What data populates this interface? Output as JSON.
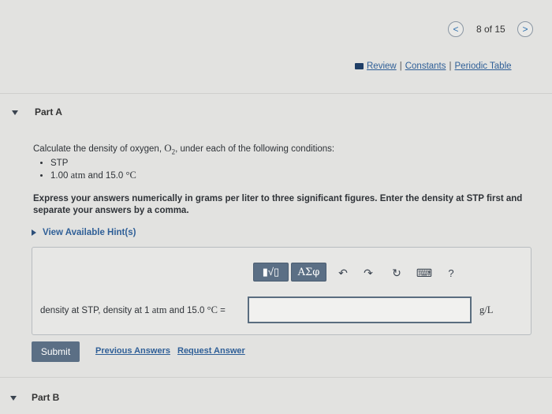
{
  "nav": {
    "prev_glyph": "<",
    "next_glyph": ">",
    "page_count": "8 of 15"
  },
  "links": {
    "review": "Review",
    "constants": "Constants",
    "periodic_table": "Periodic Table",
    "separator": "|"
  },
  "part_a": {
    "title": "Part A",
    "question_prefix": "Calculate the density of oxygen, ",
    "oxygen_symbol": "O",
    "oxygen_subscript": "2",
    "question_suffix": ", under each of the following conditions:",
    "conditions": [
      {
        "text": "STP"
      },
      {
        "value": "1.00",
        "unit": "atm",
        "mid": " and 15.0 ",
        "temp_unit": "°C"
      }
    ],
    "instruction": "Express your answers numerically in grams per liter to three significant figures. Enter the density at STP first and separate your answers by a comma.",
    "hint_label": "View Available Hint(s)",
    "answer_label_prefix": "density at STP, density at 1 ",
    "answer_label_unit1": "atm",
    "answer_label_mid": " and 15.0 ",
    "answer_label_unit2": "°C",
    "answer_label_suffix": " =",
    "answer_value": "",
    "answer_unit": "g/L",
    "toolbar": {
      "templates_label": "▮√▯",
      "symbols_label": "ΑΣφ",
      "undo_glyph": "↶",
      "redo_glyph": "↷",
      "reset_glyph": "↻",
      "keyboard_glyph": "⌨",
      "help_glyph": "?"
    },
    "submit_label": "Submit",
    "previous_answers_label": "Previous Answers",
    "request_answer_label": "Request Answer"
  },
  "part_b": {
    "title": "Part B"
  }
}
